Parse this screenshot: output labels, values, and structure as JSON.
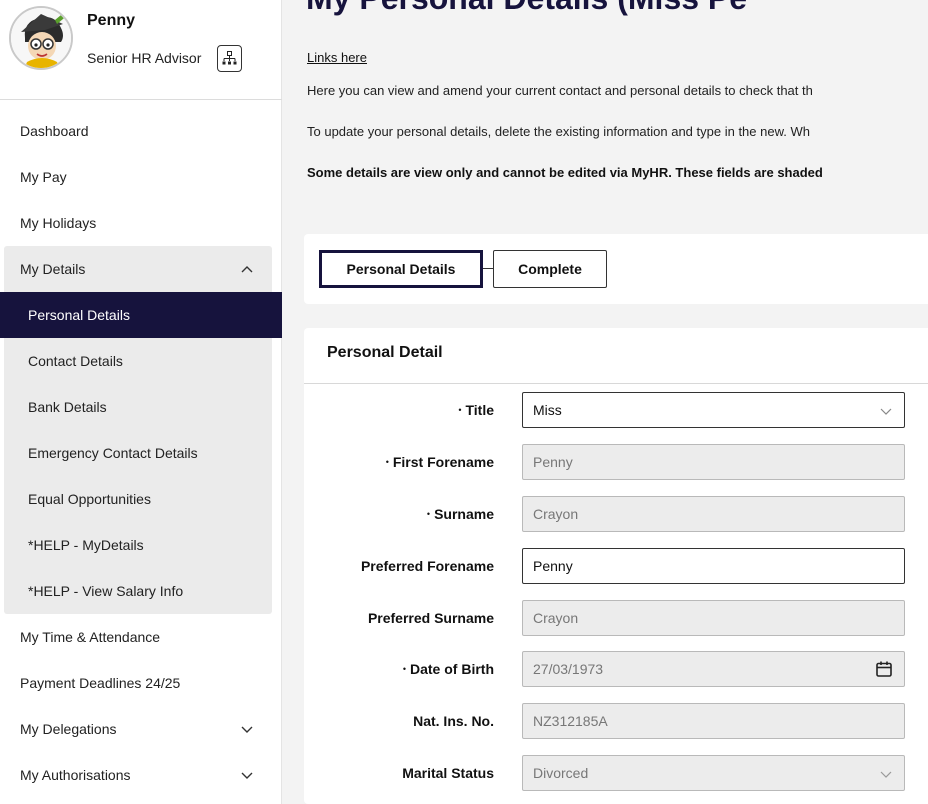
{
  "user": {
    "name": "Penny",
    "role": "Senior HR Advisor"
  },
  "nav": {
    "dashboard": "Dashboard",
    "my_pay": "My Pay",
    "my_holidays": "My Holidays",
    "my_details": {
      "label": "My Details",
      "items": [
        "Personal Details",
        "Contact Details",
        "Bank Details",
        "Emergency Contact Details",
        "Equal Opportunities",
        "*HELP - MyDetails",
        "*HELP - View Salary Info"
      ],
      "active": "Personal Details"
    },
    "my_time": "My Time & Attendance",
    "payment_deadlines": "Payment Deadlines 24/25",
    "my_delegations": "My Delegations",
    "my_authorisations": "My Authorisations"
  },
  "page": {
    "title": "My Personal Details (Miss Pe",
    "links": "Links here",
    "intro1": "Here you can view and amend your current contact and personal details to check that th",
    "intro2": "To update your personal details, delete the existing information and type in the new. Wh",
    "intro3": "Some details are view only and cannot be edited via MyHR. These fields are shaded"
  },
  "steps": [
    "Personal Details",
    "Complete"
  ],
  "form": {
    "title": "Personal Detail",
    "required_mark": "•",
    "fields": [
      {
        "label": "Title",
        "value": "Miss",
        "required": true
      },
      {
        "label": "First Forename",
        "value": "Penny",
        "required": true
      },
      {
        "label": "Surname",
        "value": "Crayon",
        "required": true
      },
      {
        "label": "Preferred Forename",
        "value": "Penny",
        "required": false
      },
      {
        "label": "Preferred Surname",
        "value": "Crayon",
        "required": false
      },
      {
        "label": "Date of Birth",
        "value": "27/03/1973",
        "required": true
      },
      {
        "label": "Nat. Ins. No.",
        "value": "NZ312185A",
        "required": false
      },
      {
        "label": "Marital Status",
        "value": "Divorced",
        "required": false
      }
    ]
  },
  "colors": {
    "accent": "#16133d",
    "readonly_bg": "#ececec",
    "page_bg": "#f3f3f3"
  }
}
